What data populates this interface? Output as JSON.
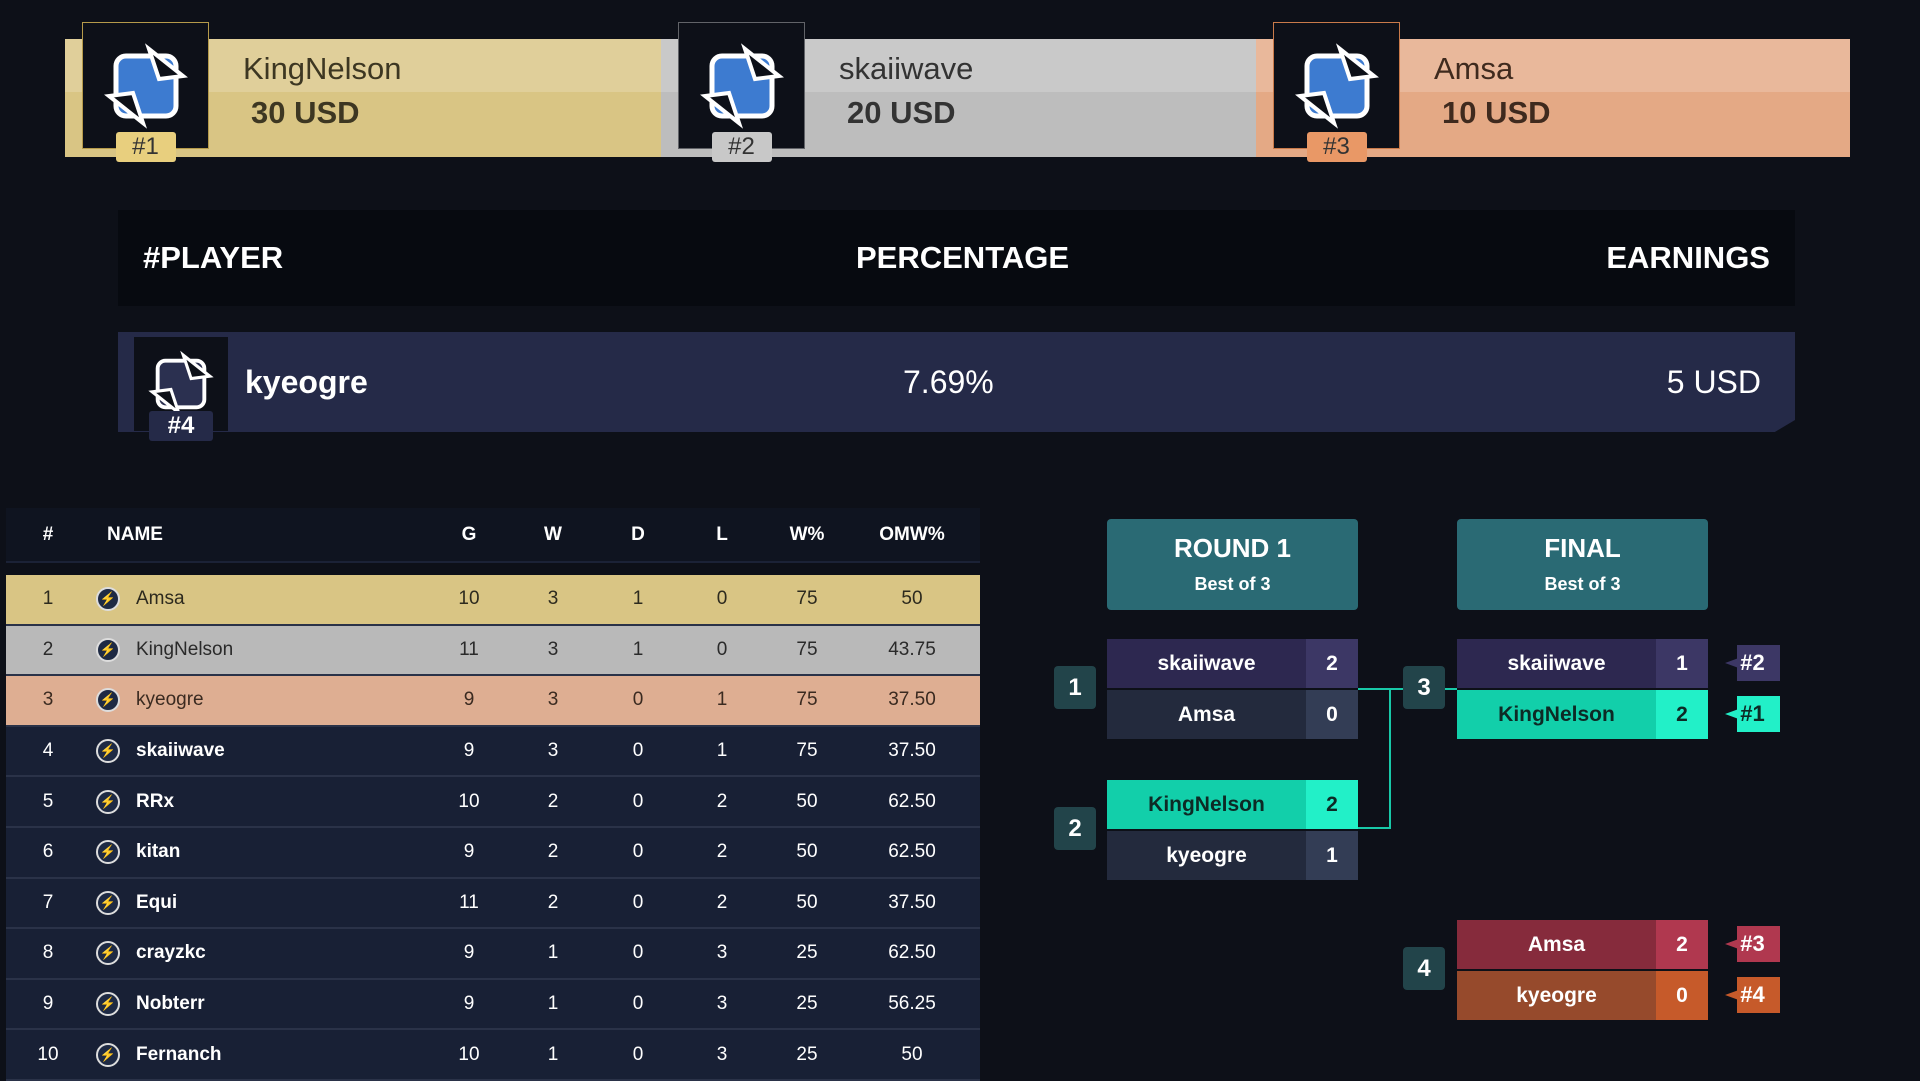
{
  "podium": [
    {
      "name": "KingNelson",
      "earnings": "30 USD",
      "rank": "#1",
      "color": "#d9c584",
      "badge": "#e8cf7e"
    },
    {
      "name": "skaiiwave",
      "earnings": "20 USD",
      "rank": "#2",
      "color": "#bdbdbd",
      "badge": "#c8c8c8"
    },
    {
      "name": "Amsa",
      "earnings": "10 USD",
      "rank": "#3",
      "color": "#e4a985",
      "badge": "#e99866"
    }
  ],
  "earnings_header": {
    "player": "#PLAYER",
    "percentage": "PERCENTAGE",
    "earnings": "EARNINGS"
  },
  "earnings_rows": [
    {
      "name": "kyeogre",
      "rank": "#4",
      "percentage": "7.69%",
      "earnings": "5 USD"
    }
  ],
  "standings": {
    "columns": [
      "#",
      "NAME",
      "G",
      "W",
      "D",
      "L",
      "W%",
      "OMW%"
    ],
    "rows": [
      [
        "1",
        "Amsa",
        "10",
        "3",
        "1",
        "0",
        "75",
        "50"
      ],
      [
        "2",
        "KingNelson",
        "11",
        "3",
        "1",
        "0",
        "75",
        "43.75"
      ],
      [
        "3",
        "kyeogre",
        "9",
        "3",
        "0",
        "1",
        "75",
        "37.50"
      ],
      [
        "4",
        "skaiiwave",
        "9",
        "3",
        "0",
        "1",
        "75",
        "37.50"
      ],
      [
        "5",
        "RRx",
        "10",
        "2",
        "0",
        "2",
        "50",
        "62.50"
      ],
      [
        "6",
        "kitan",
        "9",
        "2",
        "0",
        "2",
        "50",
        "62.50"
      ],
      [
        "7",
        "Equi",
        "11",
        "2",
        "0",
        "2",
        "50",
        "37.50"
      ],
      [
        "8",
        "crayzkc",
        "9",
        "1",
        "0",
        "3",
        "25",
        "62.50"
      ],
      [
        "9",
        "Nobterr",
        "9",
        "1",
        "0",
        "3",
        "25",
        "56.25"
      ],
      [
        "10",
        "Fernanch",
        "10",
        "1",
        "0",
        "3",
        "25",
        "50"
      ]
    ]
  },
  "bracket": {
    "rounds": [
      {
        "title": "ROUND 1",
        "format": "Best of 3"
      },
      {
        "title": "FINAL",
        "format": "Best of 3"
      }
    ],
    "matches": [
      {
        "id": "1",
        "p1": "skaiiwave",
        "s1": "2",
        "p2": "Amsa",
        "s2": "0"
      },
      {
        "id": "2",
        "p1": "KingNelson",
        "s1": "2",
        "p2": "kyeogre",
        "s2": "1"
      },
      {
        "id": "3",
        "p1": "skaiiwave",
        "s1": "1",
        "p2": "KingNelson",
        "s2": "2",
        "tag1": "#2",
        "tag2": "#1"
      },
      {
        "id": "4",
        "p1": "Amsa",
        "s1": "2",
        "p2": "kyeogre",
        "s2": "0",
        "tag1": "#3",
        "tag2": "#4"
      }
    ]
  }
}
